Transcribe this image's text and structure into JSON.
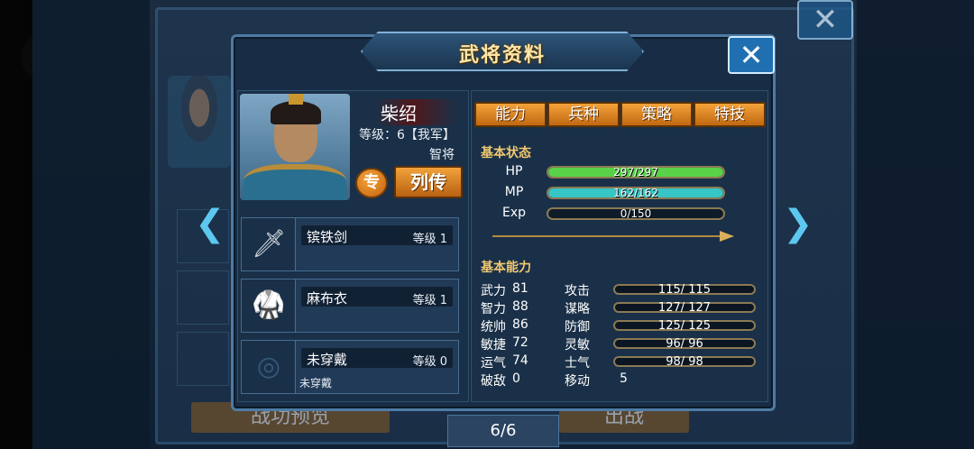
{
  "dialog": {
    "title": "武将资料",
    "close_label": "✕",
    "back_close_label": "✕"
  },
  "hero": {
    "name": "柴绍",
    "level": "等级：6【我军】",
    "role": "智将",
    "spec_button": "专",
    "bio_button": "列传"
  },
  "equipment": [
    {
      "name": "镔铁剑",
      "level": "等级 1",
      "note": "",
      "icon": "sword-icon"
    },
    {
      "name": "麻布衣",
      "level": "等级 1",
      "note": "",
      "icon": "armor-icon"
    },
    {
      "name": "未穿戴",
      "level": "等级 0",
      "note": "未穿戴",
      "icon": "empty-slot-icon"
    }
  ],
  "tabs": [
    "能力",
    "兵种",
    "策略",
    "特技"
  ],
  "basic_status": {
    "title": "基本状态",
    "bars": [
      {
        "label": "HP",
        "text": "297/297",
        "fill": 1.0,
        "color": "#59d24a"
      },
      {
        "label": "MP",
        "text": "162/162",
        "fill": 1.0,
        "color": "#37c6c6"
      },
      {
        "label": "Exp",
        "text": "0/150",
        "fill": 0.0,
        "color": "#e0c040"
      }
    ]
  },
  "basic_ability": {
    "title": "基本能力",
    "attributes": [
      {
        "label": "武力",
        "value": "81"
      },
      {
        "label": "智力",
        "value": "88"
      },
      {
        "label": "统帅",
        "value": "86"
      },
      {
        "label": "敏捷",
        "value": "72"
      },
      {
        "label": "运气",
        "value": "74"
      },
      {
        "label": "破敌",
        "value": "0"
      }
    ],
    "combat": [
      {
        "label": "攻击",
        "value": "115/ 115"
      },
      {
        "label": "谋略",
        "value": "127/ 127"
      },
      {
        "label": "防御",
        "value": "125/ 125"
      },
      {
        "label": "灵敏",
        "value": "96/ 96"
      },
      {
        "label": "士气",
        "value": "98/ 98"
      },
      {
        "label": "移动",
        "value": "5"
      }
    ]
  },
  "background": {
    "left_button": "战功预览",
    "right_button": "出战"
  },
  "pager": "6/6",
  "colors": {
    "accent": "#f0a03a",
    "panel": "#182d45",
    "border": "#4d7ba4"
  }
}
